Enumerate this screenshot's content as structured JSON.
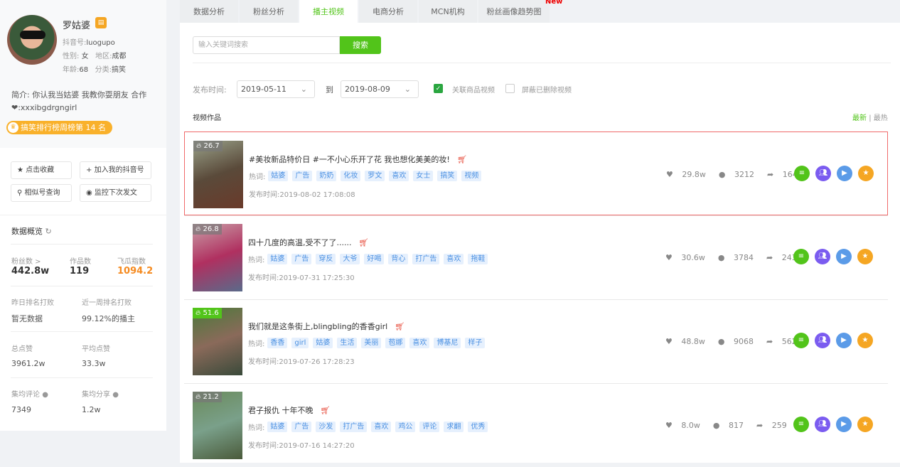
{
  "profile": {
    "name": "罗姑婆",
    "douyin_id_label": "抖音号:",
    "douyin_id": "luogupo",
    "gender_label": "性别:",
    "gender": "女",
    "region_label": "地区:",
    "region": "成都",
    "age_label": "年龄:",
    "age": "68",
    "category_label": "分类:",
    "category": "搞笑",
    "bio": "简介: 你认我当姑婆 我教你耍朋友 合作❤:xxxibgdrgngirl",
    "rank_badge": "搞笑排行榜周榜第 14 名"
  },
  "actions": {
    "favorite": "点击收藏",
    "add": "加入我的抖音号",
    "similar": "相似号查询",
    "monitor": "监控下次发文"
  },
  "overview": {
    "title": "数据概览",
    "fans_label": "粉丝数 >",
    "fans": "442.8w",
    "works_label": "作品数",
    "works": "119",
    "index_label": "飞瓜指数",
    "index": "1094.2",
    "yday_label": "昨日排名打败",
    "yday": "暂无数据",
    "week_label": "近一周排名打败",
    "week": "99.12%的播主",
    "likes_label": "总点赞",
    "likes": "3961.2w",
    "avg_likes_label": "平均点赞",
    "avg_likes": "33.3w",
    "avg_comment_label": "集均评论",
    "avg_comment": "7349",
    "avg_share_label": "集均分享",
    "avg_share": "1.2w"
  },
  "tabs": [
    "数据分析",
    "粉丝分析",
    "播主视频",
    "电商分析",
    "MCN机构",
    "粉丝画像趋势图"
  ],
  "new_badge": "New",
  "search": {
    "placeholder": "输入关键词搜索",
    "button": "搜索"
  },
  "filters": {
    "date_label": "发布时间:",
    "from": "2019-05-11",
    "to_label": "到",
    "to": "2019-08-09",
    "linked": "关联商品视频",
    "hide_deleted": "屏蔽已删除视频"
  },
  "list": {
    "title": "视频作品",
    "sort_new": "最新",
    "sort_sep": "|",
    "sort_hot": "最热",
    "hot_label": "热词:",
    "time_label": "发布时间:"
  },
  "videos": [
    {
      "heat": "26.7",
      "title": "#美妆新品特价日 #一不小心乐开了花 我也想化美美的妆!",
      "tags": [
        "姑婆",
        "广告",
        "奶奶",
        "化妆",
        "罗文",
        "喜欢",
        "女士",
        "搞笑",
        "视频"
      ],
      "time": "2019-08-02 17:08:08",
      "likes": "29.8w",
      "comments": "3212",
      "shares": "1647"
    },
    {
      "heat": "26.8",
      "title": "四十几度的高温,受不了了......",
      "tags": [
        "姑婆",
        "广告",
        "穿反",
        "大爷",
        "好喝",
        "背心",
        "打广告",
        "喜欢",
        "拖鞋"
      ],
      "time": "2019-07-31 17:25:30",
      "likes": "30.6w",
      "comments": "3784",
      "shares": "2437"
    },
    {
      "heat": "51.6",
      "title": "我们就是这条街上,blingbling的香香girl",
      "tags": [
        "香香",
        "girl",
        "姑婆",
        "生活",
        "美丽",
        "苞娜",
        "喜欢",
        "博基尼",
        "样子"
      ],
      "time": "2019-07-26 17:28:23",
      "likes": "48.8w",
      "comments": "9068",
      "shares": "5626"
    },
    {
      "heat": "21.2",
      "title": "君子报仇 十年不晚",
      "tags": [
        "姑婆",
        "广告",
        "沙发",
        "打广告",
        "喜欢",
        "鸡公",
        "评论",
        "求翻",
        "优秀"
      ],
      "time": "2019-07-16 14:27:20",
      "likes": "8.0w",
      "comments": "817",
      "shares": "259"
    }
  ]
}
